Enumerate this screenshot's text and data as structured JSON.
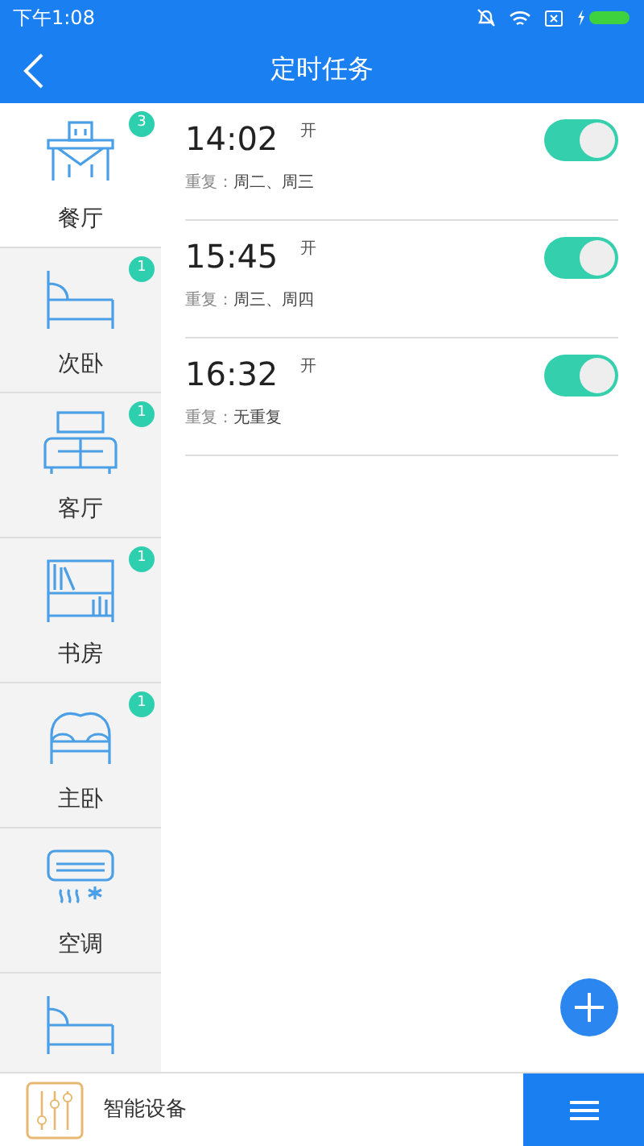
{
  "status_bar": {
    "time": "下午1:08"
  },
  "header": {
    "title": "定时任务"
  },
  "rooms": [
    {
      "kind": "dining",
      "label": "餐厅",
      "badge": "3",
      "selected": true
    },
    {
      "kind": "bed",
      "label": "次卧",
      "badge": "1",
      "selected": false
    },
    {
      "kind": "sofa",
      "label": "客厅",
      "badge": "1",
      "selected": false
    },
    {
      "kind": "shelf",
      "label": "书房",
      "badge": "1",
      "selected": false
    },
    {
      "kind": "bigbed",
      "label": "主卧",
      "badge": "1",
      "selected": false
    },
    {
      "kind": "aircon",
      "label": "空调",
      "selected": false
    },
    {
      "kind": "bed",
      "selected": false
    }
  ],
  "tasks": [
    {
      "time": "14:02",
      "state_label": "开",
      "repeat_label": "重复：",
      "repeat": "周二、周三",
      "on": true
    },
    {
      "time": "15:45",
      "state_label": "开",
      "repeat_label": "重复：",
      "repeat": "周三、周四",
      "on": true
    },
    {
      "time": "16:32",
      "state_label": "开",
      "repeat_label": "重复：",
      "repeat": "无重复",
      "on": true
    }
  ],
  "bottom_bar": {
    "label": "智能设备"
  }
}
